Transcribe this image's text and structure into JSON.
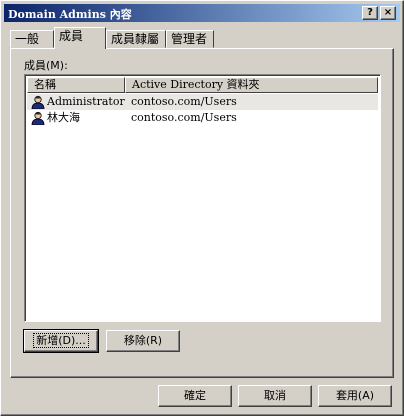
{
  "window": {
    "title": "Domain Admins 內容",
    "help_glyph": "?",
    "close_glyph": "×"
  },
  "tabs": [
    {
      "label": "一般"
    },
    {
      "label": "成員"
    },
    {
      "label": "成員隸屬"
    },
    {
      "label": "管理者"
    }
  ],
  "members": {
    "label": "成員(M):",
    "columns": [
      "名稱",
      "Active Directory 資料夾"
    ],
    "rows": [
      {
        "name": "Administrator",
        "folder": "contoso.com/Users",
        "icon": "user-icon"
      },
      {
        "name": "林大海",
        "folder": "contoso.com/Users",
        "icon": "user-icon"
      }
    ]
  },
  "buttons": {
    "add": "新增(D)...",
    "remove": "移除(R)",
    "ok": "確定",
    "cancel": "取消",
    "apply": "套用(A)"
  }
}
